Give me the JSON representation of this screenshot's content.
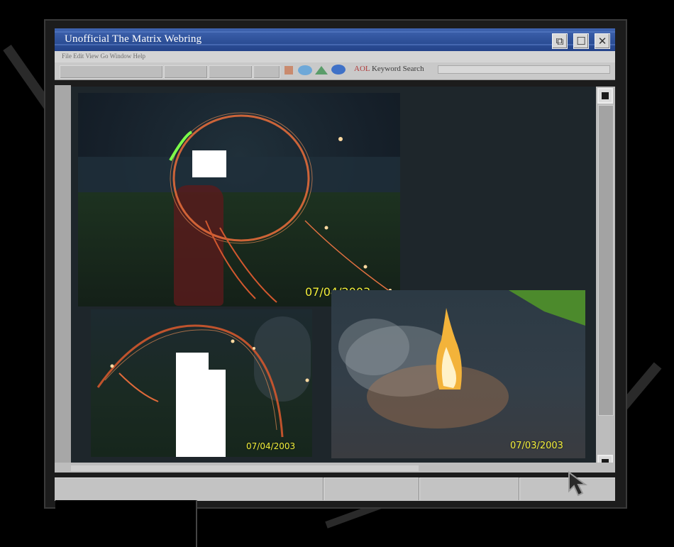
{
  "window": {
    "title": "Unofficial The Matrix Webring",
    "controls": [
      "restore",
      "maximize",
      "close"
    ]
  },
  "menubar": {
    "text": "File Edit View Go Window Help"
  },
  "toolbar": {
    "icons": [
      "stop-icon",
      "globe-icon",
      "triangle-icon",
      "chat-icon"
    ],
    "aol": "AOL",
    "keyword_search": "Keyword Search",
    "search_value": ""
  },
  "photos": [
    {
      "id": "sparkler-circle",
      "date": "07/04/2003"
    },
    {
      "id": "sparkler-arc",
      "date": "07/04/2003"
    },
    {
      "id": "fire-smoke",
      "date": "07/03/2003"
    }
  ],
  "colors": {
    "titlebar": "#2d4f97",
    "content_bg": "#1e262b",
    "date_stamp": "#f2ee3a"
  }
}
